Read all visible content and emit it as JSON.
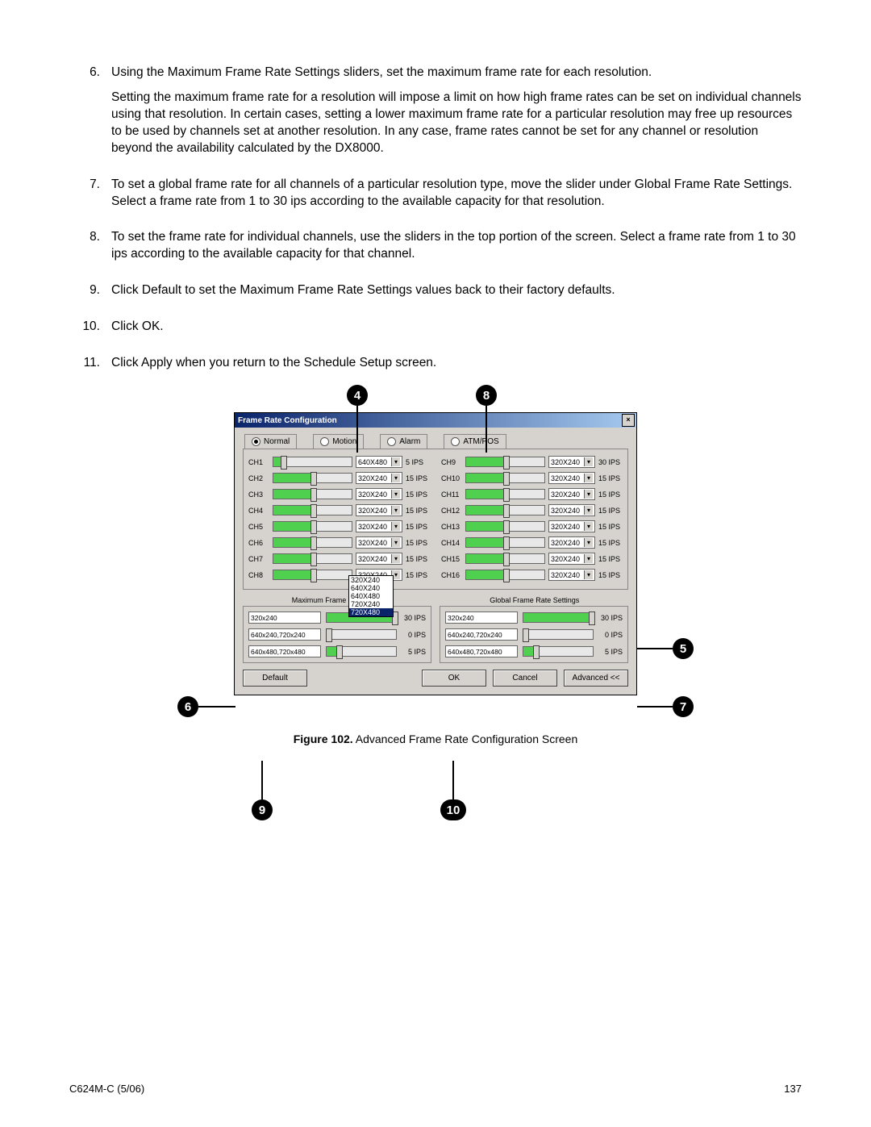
{
  "steps": [
    {
      "n": "6.",
      "paras": [
        "Using the Maximum Frame Rate Settings sliders, set the maximum frame rate for each resolution.",
        "Setting the maximum frame rate for a resolution will impose a limit on how high frame rates can be set on individual channels using that resolution. In certain cases, setting a lower maximum frame rate for a particular resolution may free up resources to be used by channels set at another resolution. In any case, frame rates cannot be set for any channel or resolution beyond the availability calculated by the DX8000."
      ]
    },
    {
      "n": "7.",
      "paras": [
        "To set a global frame rate for all channels of a particular resolution type, move the slider under Global Frame Rate Settings. Select a frame rate from 1 to 30 ips according to the available capacity for that resolution."
      ]
    },
    {
      "n": "8.",
      "paras": [
        "To set the frame rate for individual channels, use the sliders in the top portion of the screen. Select a frame rate from 1 to 30 ips according to the available capacity for that channel."
      ]
    },
    {
      "n": "9.",
      "paras": [
        "Click Default to set the Maximum Frame Rate Settings values back to their factory defaults."
      ]
    },
    {
      "n": "10.",
      "paras": [
        "Click OK."
      ]
    },
    {
      "n": "11.",
      "paras": [
        "Click Apply when you return to the Schedule Setup screen."
      ]
    }
  ],
  "callouts": {
    "c4": "4",
    "c5": "5",
    "c6": "6",
    "c7": "7",
    "c8": "8",
    "c9": "9",
    "c10": "10"
  },
  "win": {
    "title": "Frame Rate Configuration",
    "close": "×",
    "tabs": {
      "normal": "Normal",
      "motion": "Motion",
      "alarm": "Alarm",
      "atm": "ATM/POS"
    },
    "left": [
      {
        "label": "CH1",
        "res": "640X480",
        "ips": "5 IPS",
        "fill": "12%"
      },
      {
        "label": "CH2",
        "res": "320X240",
        "ips": "15 IPS",
        "fill": "50%"
      },
      {
        "label": "CH3",
        "res": "320X240",
        "ips": "15 IPS",
        "fill": "50%"
      },
      {
        "label": "CH4",
        "res": "320X240",
        "ips": "15 IPS",
        "fill": "50%"
      },
      {
        "label": "CH5",
        "res": "320X240",
        "ips": "15 IPS",
        "fill": "50%"
      },
      {
        "label": "CH6",
        "res": "320X240",
        "ips": "15 IPS",
        "fill": "50%"
      },
      {
        "label": "CH7",
        "res": "320X240",
        "ips": "15 IPS",
        "fill": "50%"
      },
      {
        "label": "CH8",
        "res": "320X240",
        "ips": "15 IPS",
        "fill": "50%"
      }
    ],
    "right": [
      {
        "label": "CH9",
        "res": "320X240",
        "ips": "30 IPS",
        "fill": "50%"
      },
      {
        "label": "CH10",
        "res": "320X240",
        "ips": "15 IPS",
        "fill": "50%"
      },
      {
        "label": "CH11",
        "res": "320X240",
        "ips": "15 IPS",
        "fill": "50%"
      },
      {
        "label": "CH12",
        "res": "320X240",
        "ips": "15 IPS",
        "fill": "50%"
      },
      {
        "label": "CH13",
        "res": "320X240",
        "ips": "15 IPS",
        "fill": "50%"
      },
      {
        "label": "CH14",
        "res": "320X240",
        "ips": "15 IPS",
        "fill": "50%"
      },
      {
        "label": "CH15",
        "res": "320X240",
        "ips": "15 IPS",
        "fill": "50%"
      },
      {
        "label": "CH16",
        "res": "320X240",
        "ips": "15 IPS",
        "fill": "50%"
      }
    ],
    "dropdown": [
      "320X240",
      "640X240",
      "640X480",
      "720X240",
      "720X480"
    ],
    "section_max": "Maximum Frame Rate Settings",
    "section_global": "Global Frame Rate Settings",
    "max_rows": [
      {
        "label": "320x240",
        "ips": "30 IPS",
        "fill": "98%"
      },
      {
        "label": "640x240,720x240",
        "ips": "0 IPS",
        "fill": "2%"
      },
      {
        "label": "640x480,720x480",
        "ips": "5 IPS",
        "fill": "18%"
      }
    ],
    "global_rows": [
      {
        "label": "320x240",
        "ips": "30 IPS",
        "fill": "98%"
      },
      {
        "label": "640x240,720x240",
        "ips": "0 IPS",
        "fill": "2%"
      },
      {
        "label": "640x480,720x480",
        "ips": "5 IPS",
        "fill": "18%"
      }
    ],
    "buttons": {
      "default": "Default",
      "ok": "OK",
      "cancel": "Cancel",
      "advanced": "Advanced <<"
    }
  },
  "caption_bold": "Figure 102.",
  "caption_rest": "  Advanced Frame Rate Configuration Screen",
  "footer_left": "C624M-C (5/06)",
  "footer_right": "137"
}
